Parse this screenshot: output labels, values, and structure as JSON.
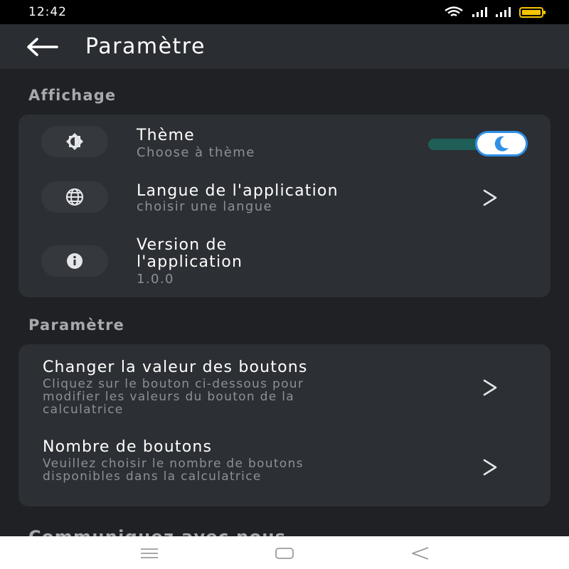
{
  "status_bar": {
    "time": "12:42",
    "icons": [
      "wifi-icon",
      "signal-icon",
      "signal-icon",
      "battery-icon"
    ],
    "battery_color": "#f5c400"
  },
  "app_bar": {
    "back_icon": "arrow-left-icon",
    "title": "Paramètre"
  },
  "sections": {
    "display": {
      "title": "Affichage",
      "theme": {
        "title": "Thème",
        "subtitle": "Choose à thème",
        "icon": "brightness-icon",
        "toggle_on": true,
        "toggle_icon": "moon-icon"
      },
      "language": {
        "title": "Langue de l'application",
        "subtitle": "choisir une langue",
        "icon": "globe-icon"
      },
      "version": {
        "title_line1": "Version de",
        "title_line2": "l'application",
        "value": "1.0.0",
        "icon": "info-icon"
      }
    },
    "settings": {
      "title": "Paramètre",
      "button_values": {
        "title": "Changer la valeur des boutons",
        "description_line1": "Cliquez sur le bouton ci-dessous pour",
        "description_line2": "modifier les valeurs du bouton de la",
        "description_line3": "calculatrice"
      },
      "button_count": {
        "title": "Nombre de boutons",
        "description_line1": "Veuillez choisir le nombre de boutons",
        "description_line2": "disponibles dans la calculatrice"
      }
    },
    "contact": {
      "title": "Communiquez avec nous"
    }
  },
  "nav_bar": {
    "icons": [
      "menu-icon",
      "home-icon",
      "back-triangle-icon"
    ]
  },
  "colors": {
    "background": "#1f2124",
    "card": "#2c2f33",
    "toggle_track": "#1f5f58",
    "toggle_border": "#2f8fe6"
  }
}
